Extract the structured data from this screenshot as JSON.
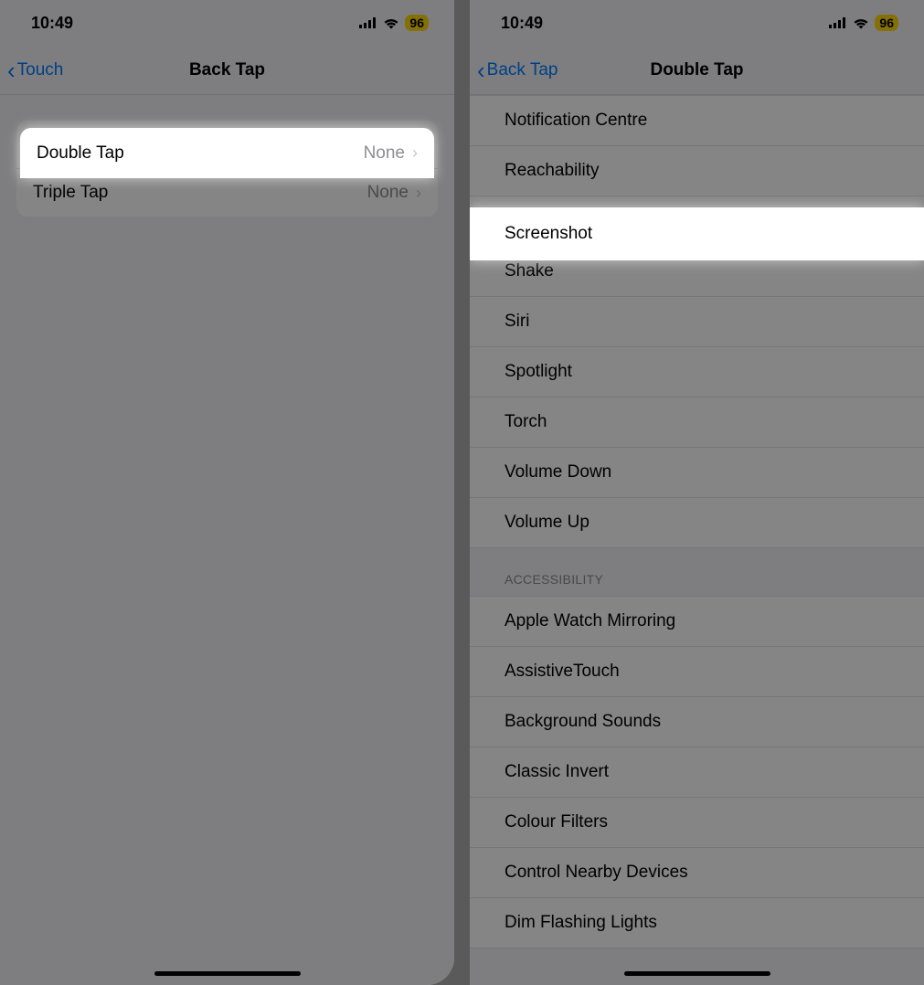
{
  "status": {
    "time": "10:49",
    "battery": "96"
  },
  "left": {
    "back_label": "Touch",
    "title": "Back Tap",
    "rows": {
      "double_tap": {
        "label": "Double Tap",
        "value": "None"
      },
      "triple_tap": {
        "label": "Triple Tap",
        "value": "None"
      }
    }
  },
  "right": {
    "back_label": "Back Tap",
    "title": "Double Tap",
    "section1": [
      "Notification Centre",
      "Reachability",
      "Screenshot",
      "Shake",
      "Siri",
      "Spotlight",
      "Torch",
      "Volume Down",
      "Volume Up"
    ],
    "section2_header": "ACCESSIBILITY",
    "section2": [
      "Apple Watch Mirroring",
      "AssistiveTouch",
      "Background Sounds",
      "Classic Invert",
      "Colour Filters",
      "Control Nearby Devices",
      "Dim Flashing Lights"
    ],
    "highlight_label": "Screenshot"
  }
}
